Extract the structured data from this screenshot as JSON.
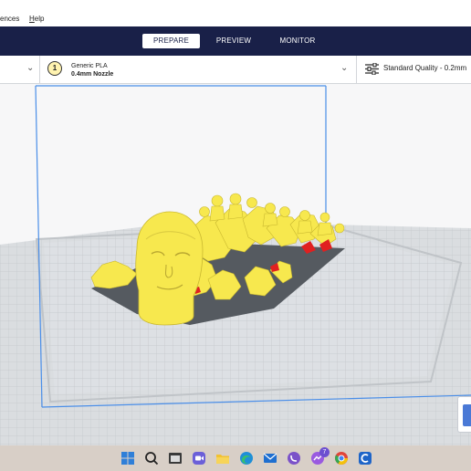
{
  "menu": {
    "items": [
      {
        "label": "ences",
        "underline": ""
      },
      {
        "label": "elp",
        "underline": "H"
      }
    ]
  },
  "header": {
    "stages": [
      "PREPARE",
      "PREVIEW",
      "MONITOR"
    ],
    "active_stage": "PREPARE"
  },
  "toolbar": {
    "extruder_number": "1",
    "material": "Generic PLA",
    "nozzle": "0.4mm Nozzle",
    "quality": "Standard Quality - 0.2mm"
  },
  "colors": {
    "header_bg": "#192048",
    "model_yellow": "#f7e84e",
    "overhang_red": "#e02020",
    "build_plate": "#d9dcdf",
    "volume_line": "#4a8ee8"
  },
  "taskbar": {
    "icons": [
      "windows-start",
      "search",
      "file-explorer",
      "zoom",
      "folder",
      "mail",
      "edge",
      "viber",
      "messenger",
      "chrome",
      "cura"
    ],
    "badge": "7"
  }
}
